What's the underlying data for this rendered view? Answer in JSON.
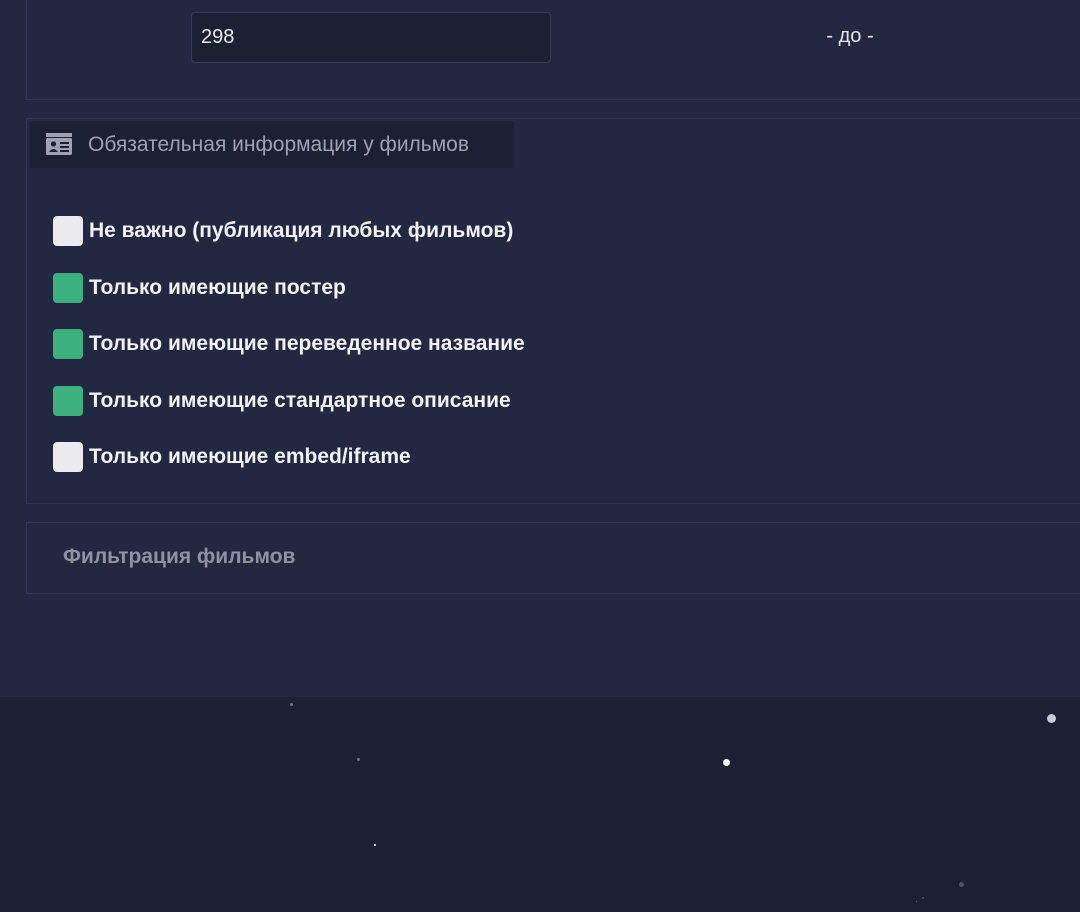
{
  "range": {
    "from_value": "298",
    "separator": "- до -"
  },
  "required_info": {
    "title": "Обязательная информация у фильмов",
    "icon": "id-card-icon",
    "options": [
      {
        "label": "Не важно (публикация любых фильмов)",
        "checked": false
      },
      {
        "label": "Только имеющие постер",
        "checked": true
      },
      {
        "label": "Только имеющие переведенное название",
        "checked": true
      },
      {
        "label": "Только имеющие стандартное описание",
        "checked": true
      },
      {
        "label": "Только имеющие embed/iframe",
        "checked": false
      }
    ]
  },
  "filter_section": {
    "title": "Фильтрация фильмов"
  },
  "colors": {
    "panel_bg": "#212840",
    "page_bg": "#1b2034",
    "checkbox_checked": "#3cb17e",
    "checkbox_unchecked": "#ececf0"
  }
}
